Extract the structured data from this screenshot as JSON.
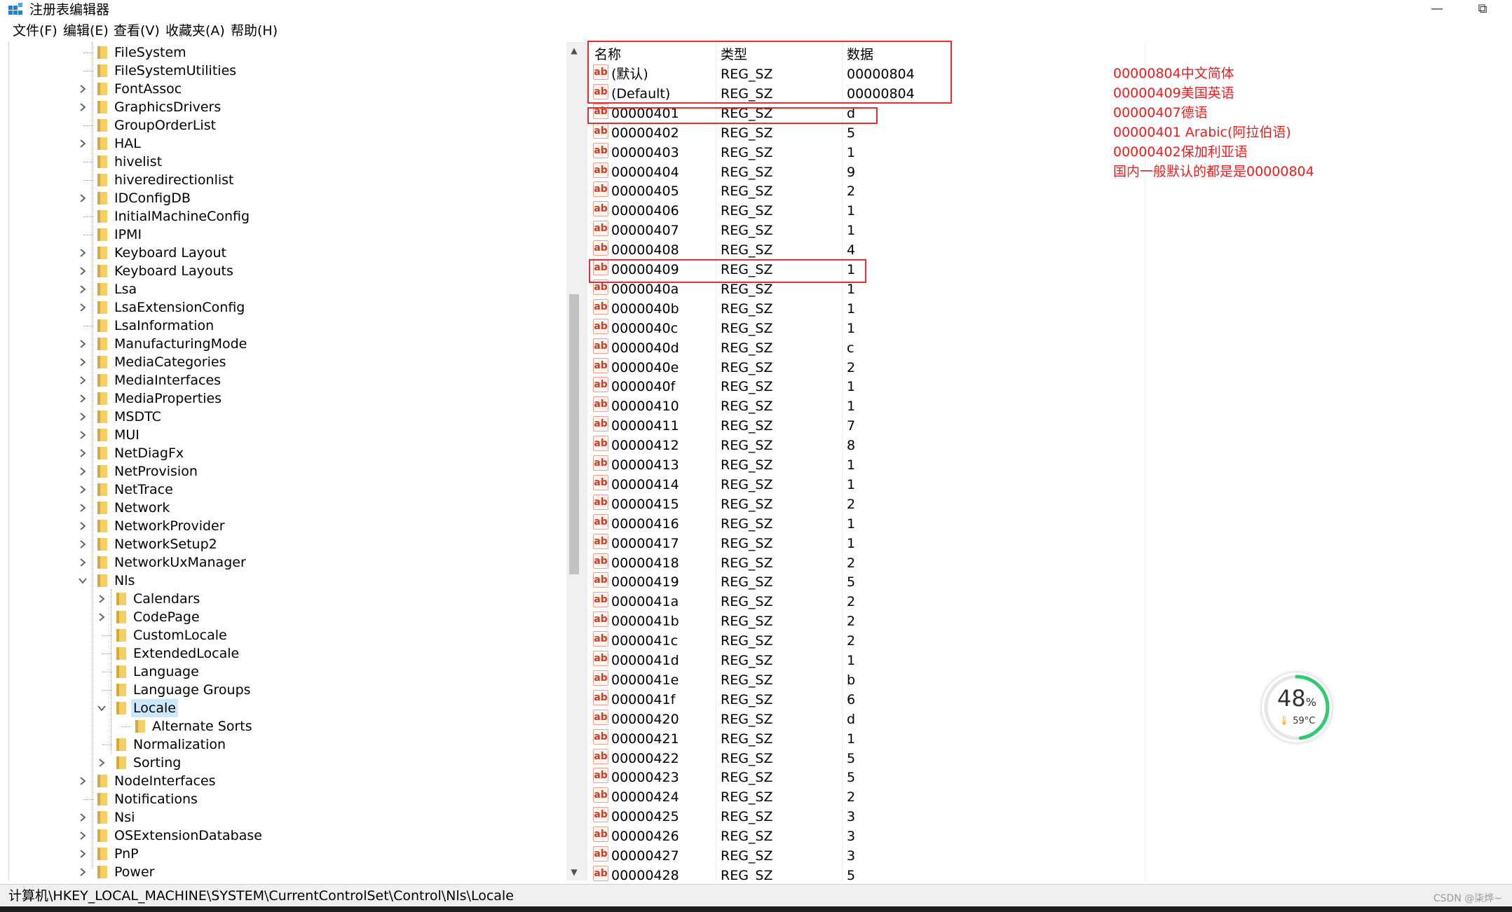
{
  "window": {
    "title": "注册表编辑器"
  },
  "menu": [
    "文件(F)",
    "编辑(E)",
    "查看(V)",
    "收藏夹(A)",
    "帮助(H)"
  ],
  "tree": [
    {
      "label": "FileSystem",
      "level": 0,
      "expander": "none"
    },
    {
      "label": "FileSystemUtilities",
      "level": 0,
      "expander": "none"
    },
    {
      "label": "FontAssoc",
      "level": 0,
      "expander": "collapsed"
    },
    {
      "label": "GraphicsDrivers",
      "level": 0,
      "expander": "collapsed"
    },
    {
      "label": "GroupOrderList",
      "level": 0,
      "expander": "none"
    },
    {
      "label": "HAL",
      "level": 0,
      "expander": "collapsed"
    },
    {
      "label": "hivelist",
      "level": 0,
      "expander": "none"
    },
    {
      "label": "hiveredirectionlist",
      "level": 0,
      "expander": "none"
    },
    {
      "label": "IDConfigDB",
      "level": 0,
      "expander": "collapsed"
    },
    {
      "label": "InitialMachineConfig",
      "level": 0,
      "expander": "none"
    },
    {
      "label": "IPMI",
      "level": 0,
      "expander": "none"
    },
    {
      "label": "Keyboard Layout",
      "level": 0,
      "expander": "collapsed"
    },
    {
      "label": "Keyboard Layouts",
      "level": 0,
      "expander": "collapsed"
    },
    {
      "label": "Lsa",
      "level": 0,
      "expander": "collapsed"
    },
    {
      "label": "LsaExtensionConfig",
      "level": 0,
      "expander": "collapsed"
    },
    {
      "label": "LsaInformation",
      "level": 0,
      "expander": "none"
    },
    {
      "label": "ManufacturingMode",
      "level": 0,
      "expander": "collapsed"
    },
    {
      "label": "MediaCategories",
      "level": 0,
      "expander": "collapsed"
    },
    {
      "label": "MediaInterfaces",
      "level": 0,
      "expander": "collapsed"
    },
    {
      "label": "MediaProperties",
      "level": 0,
      "expander": "collapsed"
    },
    {
      "label": "MSDTC",
      "level": 0,
      "expander": "collapsed"
    },
    {
      "label": "MUI",
      "level": 0,
      "expander": "collapsed"
    },
    {
      "label": "NetDiagFx",
      "level": 0,
      "expander": "collapsed"
    },
    {
      "label": "NetProvision",
      "level": 0,
      "expander": "collapsed"
    },
    {
      "label": "NetTrace",
      "level": 0,
      "expander": "collapsed"
    },
    {
      "label": "Network",
      "level": 0,
      "expander": "collapsed"
    },
    {
      "label": "NetworkProvider",
      "level": 0,
      "expander": "collapsed"
    },
    {
      "label": "NetworkSetup2",
      "level": 0,
      "expander": "collapsed"
    },
    {
      "label": "NetworkUxManager",
      "level": 0,
      "expander": "collapsed"
    },
    {
      "label": "Nls",
      "level": 0,
      "expander": "expanded"
    },
    {
      "label": "Calendars",
      "level": 1,
      "expander": "collapsed"
    },
    {
      "label": "CodePage",
      "level": 1,
      "expander": "collapsed"
    },
    {
      "label": "CustomLocale",
      "level": 1,
      "expander": "none"
    },
    {
      "label": "ExtendedLocale",
      "level": 1,
      "expander": "none"
    },
    {
      "label": "Language",
      "level": 1,
      "expander": "none"
    },
    {
      "label": "Language Groups",
      "level": 1,
      "expander": "none"
    },
    {
      "label": "Locale",
      "level": 1,
      "expander": "expanded",
      "selected": true
    },
    {
      "label": "Alternate Sorts",
      "level": 2,
      "expander": "none"
    },
    {
      "label": "Normalization",
      "level": 1,
      "expander": "none"
    },
    {
      "label": "Sorting",
      "level": 1,
      "expander": "collapsed"
    },
    {
      "label": "NodeInterfaces",
      "level": 0,
      "expander": "collapsed"
    },
    {
      "label": "Notifications",
      "level": 0,
      "expander": "none"
    },
    {
      "label": "Nsi",
      "level": 0,
      "expander": "collapsed"
    },
    {
      "label": "OSExtensionDatabase",
      "level": 0,
      "expander": "collapsed"
    },
    {
      "label": "PnP",
      "level": 0,
      "expander": "collapsed"
    },
    {
      "label": "Power",
      "level": 0,
      "expander": "collapsed"
    }
  ],
  "columns": [
    "名称",
    "类型",
    "数据"
  ],
  "values": [
    {
      "name": "(默认)",
      "type": "REG_SZ",
      "data": "00000804"
    },
    {
      "name": "(Default)",
      "type": "REG_SZ",
      "data": "00000804"
    },
    {
      "name": "00000401",
      "type": "REG_SZ",
      "data": "d"
    },
    {
      "name": "00000402",
      "type": "REG_SZ",
      "data": "5"
    },
    {
      "name": "00000403",
      "type": "REG_SZ",
      "data": "1"
    },
    {
      "name": "00000404",
      "type": "REG_SZ",
      "data": "9"
    },
    {
      "name": "00000405",
      "type": "REG_SZ",
      "data": "2"
    },
    {
      "name": "00000406",
      "type": "REG_SZ",
      "data": "1"
    },
    {
      "name": "00000407",
      "type": "REG_SZ",
      "data": "1"
    },
    {
      "name": "00000408",
      "type": "REG_SZ",
      "data": "4"
    },
    {
      "name": "00000409",
      "type": "REG_SZ",
      "data": "1"
    },
    {
      "name": "0000040a",
      "type": "REG_SZ",
      "data": "1"
    },
    {
      "name": "0000040b",
      "type": "REG_SZ",
      "data": "1"
    },
    {
      "name": "0000040c",
      "type": "REG_SZ",
      "data": "1"
    },
    {
      "name": "0000040d",
      "type": "REG_SZ",
      "data": "c"
    },
    {
      "name": "0000040e",
      "type": "REG_SZ",
      "data": "2"
    },
    {
      "name": "0000040f",
      "type": "REG_SZ",
      "data": "1"
    },
    {
      "name": "00000410",
      "type": "REG_SZ",
      "data": "1"
    },
    {
      "name": "00000411",
      "type": "REG_SZ",
      "data": "7"
    },
    {
      "name": "00000412",
      "type": "REG_SZ",
      "data": "8"
    },
    {
      "name": "00000413",
      "type": "REG_SZ",
      "data": "1"
    },
    {
      "name": "00000414",
      "type": "REG_SZ",
      "data": "1"
    },
    {
      "name": "00000415",
      "type": "REG_SZ",
      "data": "2"
    },
    {
      "name": "00000416",
      "type": "REG_SZ",
      "data": "1"
    },
    {
      "name": "00000417",
      "type": "REG_SZ",
      "data": "1"
    },
    {
      "name": "00000418",
      "type": "REG_SZ",
      "data": "2"
    },
    {
      "name": "00000419",
      "type": "REG_SZ",
      "data": "5"
    },
    {
      "name": "0000041a",
      "type": "REG_SZ",
      "data": "2"
    },
    {
      "name": "0000041b",
      "type": "REG_SZ",
      "data": "2"
    },
    {
      "name": "0000041c",
      "type": "REG_SZ",
      "data": "2"
    },
    {
      "name": "0000041d",
      "type": "REG_SZ",
      "data": "1"
    },
    {
      "name": "0000041e",
      "type": "REG_SZ",
      "data": "b"
    },
    {
      "name": "0000041f",
      "type": "REG_SZ",
      "data": "6"
    },
    {
      "name": "00000420",
      "type": "REG_SZ",
      "data": "d"
    },
    {
      "name": "00000421",
      "type": "REG_SZ",
      "data": "1"
    },
    {
      "name": "00000422",
      "type": "REG_SZ",
      "data": "5"
    },
    {
      "name": "00000423",
      "type": "REG_SZ",
      "data": "5"
    },
    {
      "name": "00000424",
      "type": "REG_SZ",
      "data": "2"
    },
    {
      "name": "00000425",
      "type": "REG_SZ",
      "data": "3"
    },
    {
      "name": "00000426",
      "type": "REG_SZ",
      "data": "3"
    },
    {
      "name": "00000427",
      "type": "REG_SZ",
      "data": "3"
    },
    {
      "name": "00000428",
      "type": "REG_SZ",
      "data": "5"
    }
  ],
  "value_icon_text": "ab",
  "annotations": [
    "00000804中文简体",
    "00000409美国英语",
    "00000407德语",
    "00000401 Arabic(阿拉伯语)",
    "00000402保加利亚语",
    "国内一般默认的都是是00000804"
  ],
  "gauge": {
    "percent": 48,
    "percent_text": "48",
    "percent_unit": "%",
    "temp_text": "59°C",
    "ring_color": "#2ecc71"
  },
  "status": {
    "path": "计算机\\HKEY_LOCAL_MACHINE\\SYSTEM\\CurrentControlSet\\Control\\Nls\\Locale"
  },
  "watermark": "CSDN @柒烨~",
  "colors": {
    "annotation": "#ee1c1c",
    "selection": "#cce8ff",
    "folder": "#f3cf66"
  }
}
